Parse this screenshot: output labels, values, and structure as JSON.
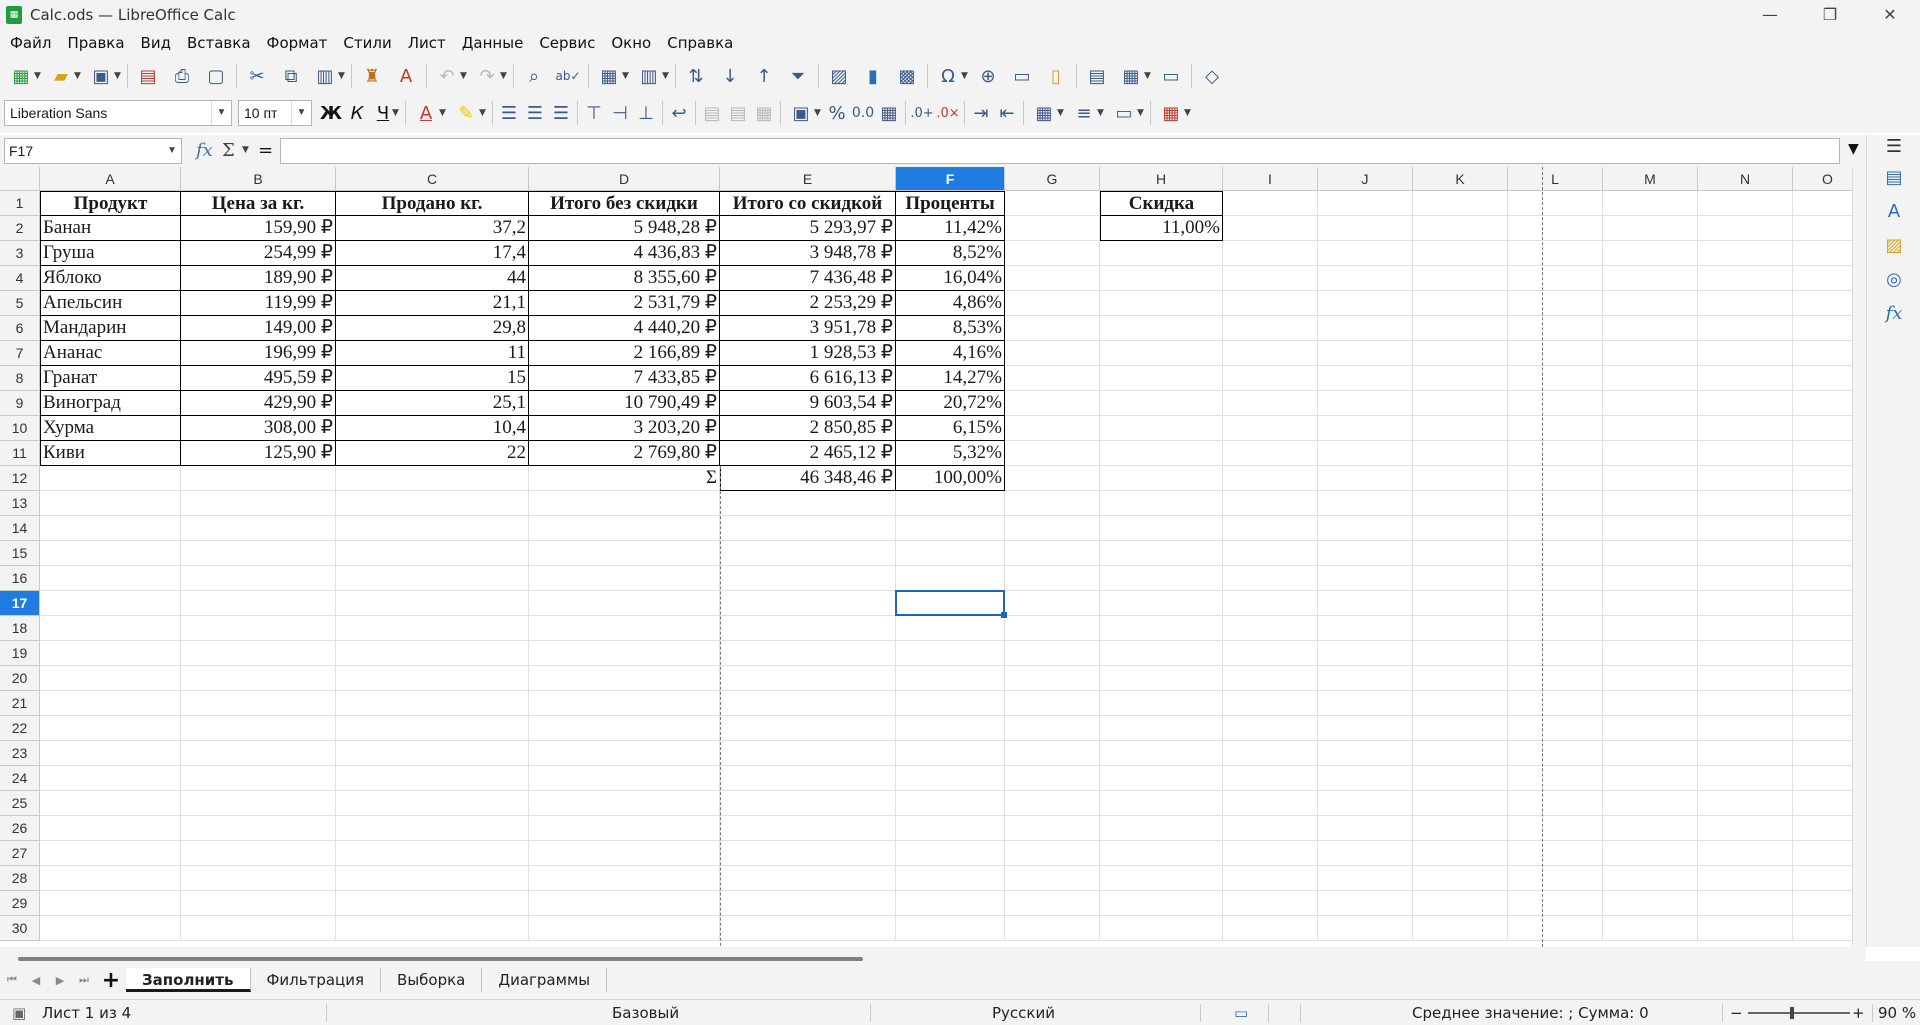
{
  "window": {
    "title": "Calc.ods — LibreOffice Calc",
    "app_icon": "spreadsheet-icon"
  },
  "menu": [
    "Файл",
    "Правка",
    "Вид",
    "Вставка",
    "Формат",
    "Стили",
    "Лист",
    "Данные",
    "Сервис",
    "Окно",
    "Справка"
  ],
  "format_bar": {
    "font_name": "Liberation Sans",
    "font_size": "10 пт",
    "bold": "Ж",
    "italic": "К",
    "underline": "Ч"
  },
  "formula_bar": {
    "cell_ref": "F17",
    "content": ""
  },
  "columns": [
    "A",
    "B",
    "C",
    "D",
    "E",
    "F",
    "G",
    "H",
    "I",
    "J",
    "K",
    "L",
    "M",
    "N",
    "O"
  ],
  "rows": [
    "1",
    "2",
    "3",
    "4",
    "5",
    "6",
    "7",
    "8",
    "9",
    "10",
    "11",
    "12",
    "13",
    "14",
    "15",
    "16",
    "17",
    "18",
    "19",
    "20",
    "21",
    "22",
    "23",
    "24",
    "25",
    "26",
    "27",
    "28",
    "29",
    "30"
  ],
  "active": {
    "column": "F",
    "row": "17"
  },
  "table": {
    "headers": [
      "Продукт",
      "Цена за кг.",
      "Продано кг.",
      "Итого без скидки",
      "Итого со скидкой",
      "Проценты"
    ],
    "rows": [
      [
        "Банан",
        "159,90 ₽",
        "37,2",
        "5 948,28 ₽",
        "5 293,97 ₽",
        "11,42%"
      ],
      [
        "Груша",
        "254,99 ₽",
        "17,4",
        "4 436,83 ₽",
        "3 948,78 ₽",
        "8,52%"
      ],
      [
        "Яблоко",
        "189,90 ₽",
        "44",
        "8 355,60 ₽",
        "7 436,48 ₽",
        "16,04%"
      ],
      [
        "Апельсин",
        "119,99 ₽",
        "21,1",
        "2 531,79 ₽",
        "2 253,29 ₽",
        "4,86%"
      ],
      [
        "Мандарин",
        "149,00 ₽",
        "29,8",
        "4 440,20 ₽",
        "3 951,78 ₽",
        "8,53%"
      ],
      [
        "Ананас",
        "196,99 ₽",
        "11",
        "2 166,89 ₽",
        "1 928,53 ₽",
        "4,16%"
      ],
      [
        "Гранат",
        "495,59 ₽",
        "15",
        "7 433,85 ₽",
        "6 616,13 ₽",
        "14,27%"
      ],
      [
        "Виноград",
        "429,90 ₽",
        "25,1",
        "10 790,49 ₽",
        "9 603,54 ₽",
        "20,72%"
      ],
      [
        "Хурма",
        "308,00 ₽",
        "10,4",
        "3 203,20 ₽",
        "2 850,85 ₽",
        "6,15%"
      ],
      [
        "Киви",
        "125,90 ₽",
        "22",
        "2 769,80 ₽",
        "2 465,12 ₽",
        "5,32%"
      ]
    ],
    "total_label": "Σ",
    "total_value": "46 348,46 ₽",
    "total_percent": "100,00%"
  },
  "discount": {
    "label": "Скидка",
    "value": "11,00%"
  },
  "sheets": [
    "Заполнить",
    "Фильтрация",
    "Выборка",
    "Диаграммы"
  ],
  "active_sheet": "Заполнить",
  "status": {
    "sheet_info": "Лист 1 из 4",
    "page_style": "Базовый",
    "language": "Русский",
    "summary": "Среднее значение: ; Сумма: 0",
    "zoom": "90 %"
  },
  "colors": {
    "selection": "#1f7ce1",
    "chrome": "#f3f3f3"
  }
}
